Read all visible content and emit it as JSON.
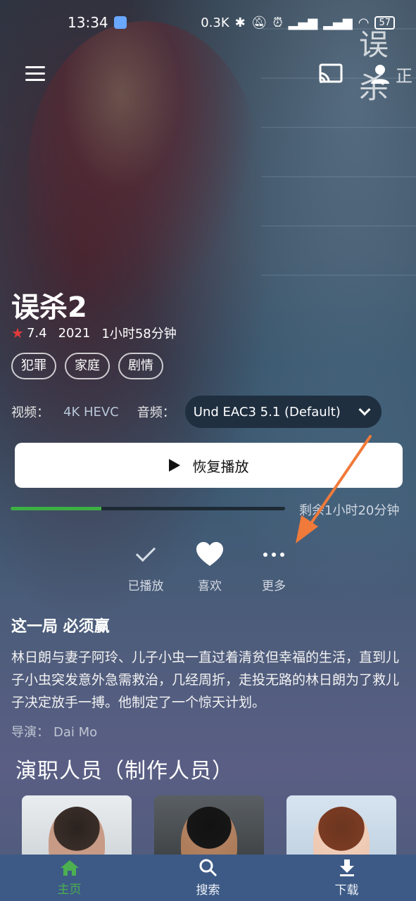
{
  "status_bar": {
    "time": "13:34",
    "net_speed": "0.3K",
    "battery": "57"
  },
  "top_bar": {
    "corner_text": "正",
    "logo_text": "误杀"
  },
  "movie": {
    "title": "误杀2",
    "rating": "7.4",
    "year": "2021",
    "duration": "1小时58分钟",
    "genres": [
      "犯罪",
      "家庭",
      "剧情"
    ],
    "video_label": "视频：",
    "video_value": "4K HEVC",
    "audio_label": "音频：",
    "audio_value": "Und EAC3 5.1 (Default)",
    "resume_label": "恢复播放",
    "progress_fraction": 0.33,
    "remaining": "剩余1小时20分钟",
    "tagline": "这一局 必须赢",
    "overview": "林日朗与妻子阿玲、儿子小虫一直过着清贫但幸福的生活，直到儿子小虫突发意外急需救治，几经周折，走投无路的林日朗为了救儿子决定放手一搏。他制定了一个惊天计划。",
    "director_label": "导演：",
    "director": "Dai Mo"
  },
  "actions": {
    "played": "已播放",
    "favorite": "喜欢",
    "more": "更多"
  },
  "cast": {
    "heading": "演职人员（制作人员）"
  },
  "bottom_nav": {
    "home": "主页",
    "search": "搜索",
    "downloads": "下载"
  },
  "colors": {
    "progress": "#3cb043",
    "nav_bg": "#3d5a86",
    "nav_active": "#4caf50",
    "star": "#e23b3b",
    "annotation_arrow": "#f07a3a"
  }
}
